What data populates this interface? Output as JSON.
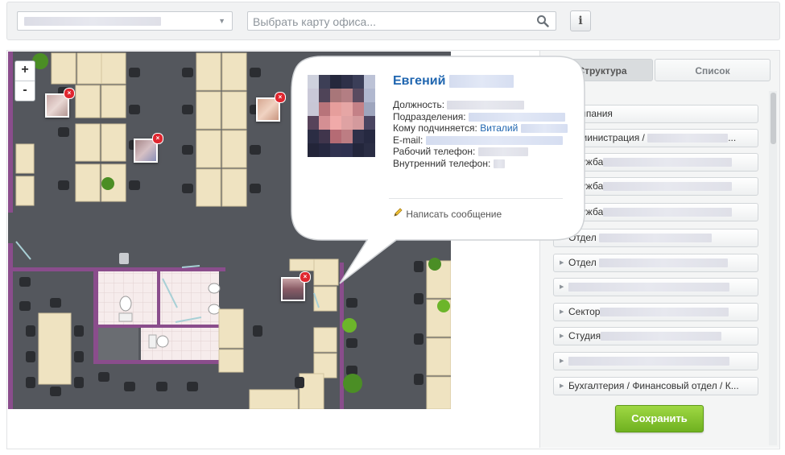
{
  "toolbar": {
    "search_placeholder": "Выбрать карту офиса...",
    "info_label": "i"
  },
  "map": {
    "zoom_in": "+",
    "zoom_out": "-"
  },
  "popup": {
    "name": "Евгений",
    "position_label": "Должность:",
    "department_label": "Подразделения:",
    "manager_label": "Кому подчиняется:",
    "manager_name": "Виталий",
    "email_label": "E-mail:",
    "work_phone_label": "Рабочий телефон:",
    "internal_phone_label": "Внутренний телефон:",
    "send_message": "Написать сообщение"
  },
  "tabs": {
    "structure": "Структура",
    "list": "Список"
  },
  "departments": [
    "Компания",
    "Администрация /",
    "Служба",
    "Служба",
    "Служба",
    "Отдел",
    "Отдел",
    "",
    "Сектор",
    "Студия",
    "",
    "Бухгалтерия / Финансовый отдел / К..."
  ],
  "actions": {
    "save": "Сохранить"
  }
}
